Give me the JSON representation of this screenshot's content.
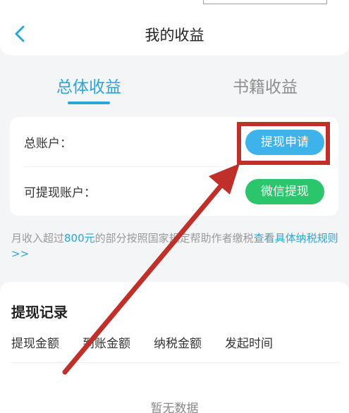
{
  "header": {
    "title": "我的收益",
    "back_icon": "chevron-left-icon"
  },
  "tabs": [
    {
      "label": "总体收益",
      "active": true
    },
    {
      "label": "书籍收益",
      "active": false
    }
  ],
  "account": {
    "total_label": "总账户：",
    "apply_button": "提现申请",
    "withdrawable_label": "可提现账户：",
    "wechat_button": "微信提现"
  },
  "tax_note": {
    "prefix": "月收入超过",
    "amount": "800元",
    "middle": "的部分按照国家规定帮助作者缴税",
    "link": "查看具体纳税规则>>"
  },
  "records": {
    "title": "提现记录",
    "columns": [
      "提现金额",
      "到账金额",
      "纳税金额",
      "发起时间"
    ],
    "empty": "暂无数据"
  },
  "colors": {
    "accent": "#2aa5d8",
    "apply_button": "#3eb2ea",
    "wechat_button": "#2bc56b",
    "annotation": "#c0302a"
  }
}
